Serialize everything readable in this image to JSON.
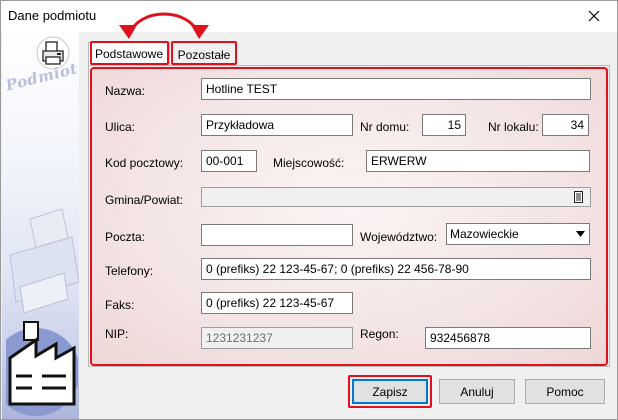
{
  "window": {
    "title": "Dane podmiotu"
  },
  "sidebar": {
    "label": "Podmiot"
  },
  "tabs": [
    {
      "label": "Podstawowe",
      "active": true
    },
    {
      "label": "Pozostałe",
      "active": false
    }
  ],
  "form": {
    "nazwa": {
      "label": "Nazwa:",
      "value": "Hotline TEST"
    },
    "ulica": {
      "label": "Ulica:",
      "value": "Przykładowa"
    },
    "nr_domu": {
      "label": "Nr domu:",
      "value": "15"
    },
    "nr_lokalu": {
      "label": "Nr lokalu:",
      "value": "34"
    },
    "kod": {
      "label": "Kod pocztowy:",
      "value": "00-001"
    },
    "miejscowosc": {
      "label": "Miejscowość:",
      "value": "ERWERW"
    },
    "gmina": {
      "label": "Gmina/Powiat:",
      "value": ""
    },
    "poczta": {
      "label": "Poczta:",
      "value": ""
    },
    "wojewodztwo": {
      "label": "Województwo:",
      "value": "Mazowieckie"
    },
    "telefony": {
      "label": "Telefony:",
      "value": "0 (prefiks) 22 123-45-67; 0 (prefiks) 22 456-78-90"
    },
    "faks": {
      "label": "Faks:",
      "value": "0 (prefiks) 22 123-45-67"
    },
    "nip": {
      "label": "NIP:",
      "value": "1231231237"
    },
    "regon": {
      "label": "Regon:",
      "value": "932456878"
    }
  },
  "buttons": {
    "save": "Zapisz",
    "cancel": "Anuluj",
    "help": "Pomoc"
  },
  "colors": {
    "highlight": "#e0101c",
    "accent": "#0078d7"
  }
}
